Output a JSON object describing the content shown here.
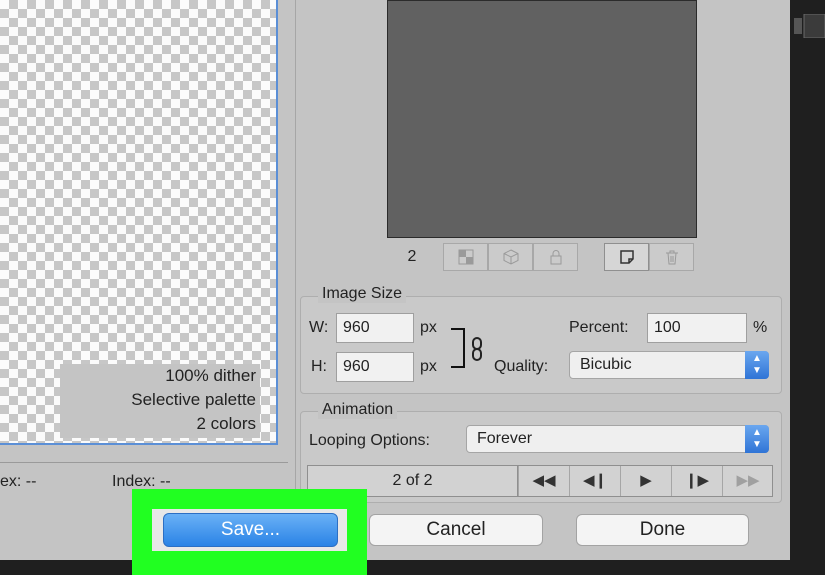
{
  "canvas": {
    "info": [
      "100% dither",
      "Selective palette",
      "2 colors"
    ]
  },
  "status": {
    "left": "ex: --",
    "index": "Index: --"
  },
  "preview": {
    "frame_number": "2"
  },
  "image_size": {
    "legend": "Image Size",
    "w_label": "W:",
    "w_value": "960",
    "h_label": "H:",
    "h_value": "960",
    "unit": "px",
    "percent_label": "Percent:",
    "percent_value": "100",
    "percent_unit": "%",
    "quality_label": "Quality:",
    "quality_value": "Bicubic"
  },
  "animation": {
    "legend": "Animation",
    "looping_label": "Looping Options:",
    "looping_value": "Forever",
    "frame_count": "2 of 2"
  },
  "buttons": {
    "save": "Save...",
    "cancel": "Cancel",
    "done": "Done"
  },
  "colors": {
    "highlight": "#21ff21",
    "accent": "#2a83e6"
  }
}
